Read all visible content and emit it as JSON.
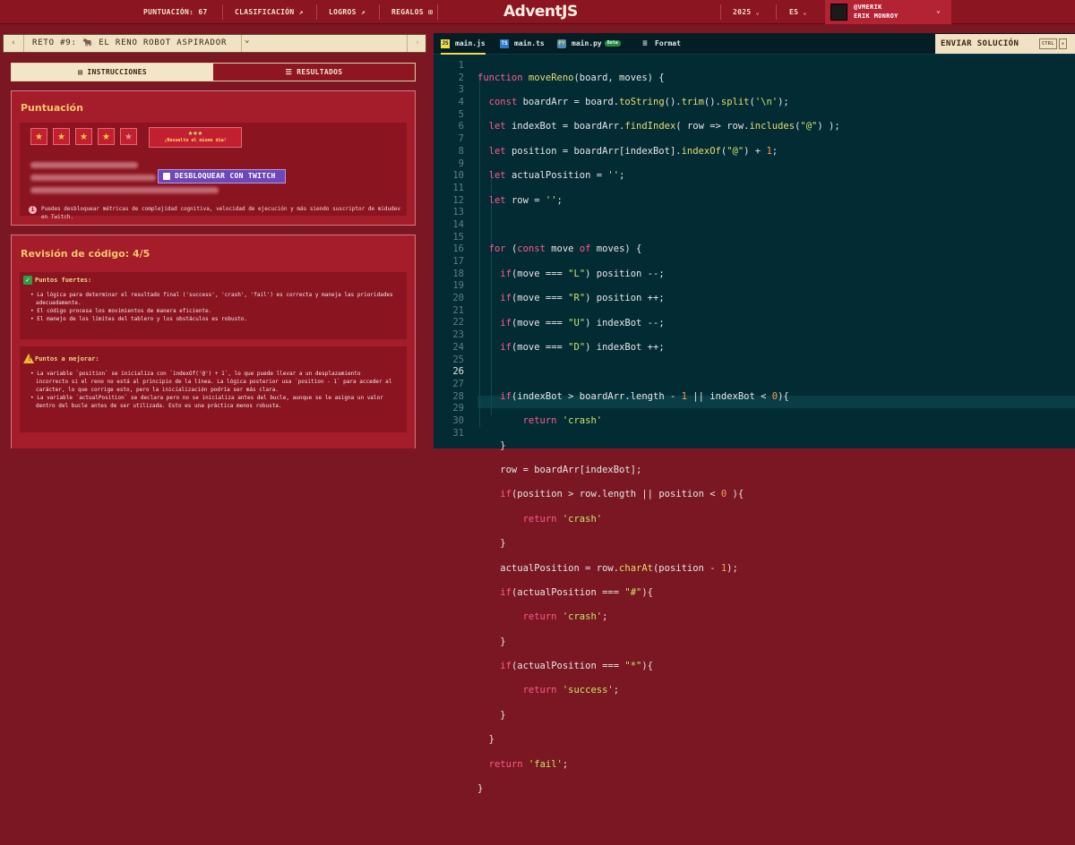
{
  "topbar": {
    "puntuacion_label": "PUNTUACIÓN:",
    "puntuacion_value": "67",
    "clasificacion": "CLASIFICACIÓN ↗",
    "logros": "LOGROS ↗",
    "regalos": "REGALOS",
    "brand": "AdventJS",
    "year": "2025",
    "lang": "ES",
    "user_handle": "@VMERIK",
    "user_name": "ERIK MONROY"
  },
  "challenge": {
    "title": "RETO #9: 🐂 EL RENO ROBOT ASPIRADOR"
  },
  "tabs": {
    "instrucciones": "INSTRUCCIONES",
    "resultados": "RESULTADOS"
  },
  "score": {
    "heading": "Puntuación",
    "stars_filled": 4,
    "stars_total": 5,
    "badge_stars": "★★★",
    "badge_text": "¡Resuelto el mismo día!",
    "twitch_button": "DESBLOQUEAR CON TWITCH",
    "note": "Puedes desbloquear métricas de complejidad cognitiva, velocidad de ejecución y más siendo suscriptor de midudev en Twitch."
  },
  "review": {
    "heading": "Revisión de código: 4/5",
    "strengths_title": "Puntos fuertes:",
    "strengths": [
      "La lógica para determinar el resultado final ('success', 'crash', 'fail') es correcta y maneja las prioridades adecuadamente.",
      "El código procesa los movimientos de manera eficiente.",
      "El manejo de los límites del tablero y los obstáculos es robusto."
    ],
    "improve_title": "Puntos a mejorar:",
    "improvements": [
      "La variable `position` se inicializa con `indexOf('@') + 1`, lo que puede llevar a un desplazamiento incorrecto si el reno no está al principio de la línea. La lógica posterior usa `position - 1` para acceder al carácter, lo que corrige esto, pero la inicialización podría ser más clara.",
      "La variable `actualPosition` se declara pero no se inicializa antes del bucle, aunque se le asigna un valor dentro del bucle antes de ser utilizada. Esto es una práctica menos robusta."
    ]
  },
  "editor": {
    "tabs": [
      {
        "label": "main.js",
        "icon": "JS",
        "color": "#f0db4f"
      },
      {
        "label": "main.ts",
        "icon": "TS",
        "color": "#3178c6"
      },
      {
        "label": "main.py",
        "icon": "PY",
        "color": "#4b8bbe",
        "badge": "Beta"
      },
      {
        "label": "Format",
        "icon": "≡",
        "color": "#e6e6e6"
      }
    ],
    "submit": "ENVIAR SOLUCIÓN",
    "shortcut_ctrl": "CTRL",
    "shortcut_key": "+",
    "current_line": 26
  }
}
